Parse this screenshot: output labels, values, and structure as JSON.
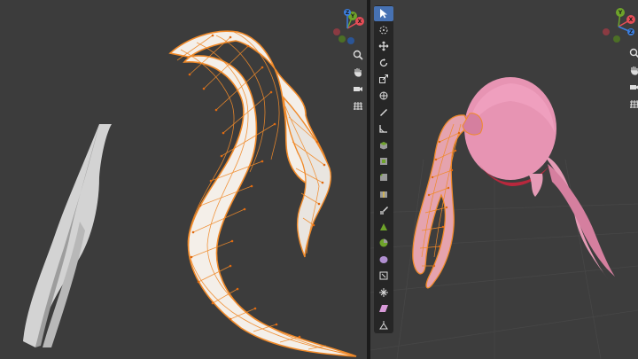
{
  "colors": {
    "viewport_bg": "#3c3c3c",
    "panel_divider": "#1b1b1b",
    "toolbar_bg": "#262626",
    "active_tool": "#4772b3",
    "mesh_surface": "#f4efe9",
    "mesh_edge": "#f08a2a",
    "hair_pink": "#e59bb6",
    "axis_x": "#e44d56",
    "axis_y": "#6ea32a",
    "axis_z": "#3b7fe0"
  },
  "left_viewport": {
    "gizmo_labels": {
      "x": "X",
      "y": "Y",
      "z": "Z"
    },
    "nav_icons": [
      "zoom-icon",
      "pan-hand-icon",
      "camera-icon",
      "grid-icon"
    ]
  },
  "right_viewport": {
    "gizmo_labels": {
      "x": "X",
      "y": "Y",
      "z": "Z"
    },
    "nav_icons": [
      "zoom-icon",
      "pan-hand-icon",
      "camera-icon",
      "grid-icon"
    ]
  },
  "toolbar": {
    "tools": [
      {
        "name": "select-tool",
        "active": true
      },
      {
        "name": "cursor-tool",
        "active": false
      },
      {
        "name": "move-tool",
        "active": false
      },
      {
        "name": "rotate-tool",
        "active": false
      },
      {
        "name": "scale-tool",
        "active": false
      },
      {
        "name": "transform-tool",
        "active": false
      },
      {
        "name": "annotate-tool",
        "active": false
      },
      {
        "name": "measure-tool",
        "active": false
      },
      {
        "name": "extrude-tool",
        "active": false
      },
      {
        "name": "inset-tool",
        "active": false
      },
      {
        "name": "bevel-tool",
        "active": false
      },
      {
        "name": "loop-cut-tool",
        "active": false
      },
      {
        "name": "knife-tool",
        "active": false
      },
      {
        "name": "poly-build-tool",
        "active": false
      },
      {
        "name": "spin-tool",
        "active": false
      },
      {
        "name": "smooth-tool",
        "active": false
      },
      {
        "name": "edge-slide-tool",
        "active": false
      },
      {
        "name": "shrink-fatten-tool",
        "active": false
      },
      {
        "name": "shear-tool",
        "active": false
      },
      {
        "name": "rip-tool",
        "active": false
      }
    ]
  }
}
